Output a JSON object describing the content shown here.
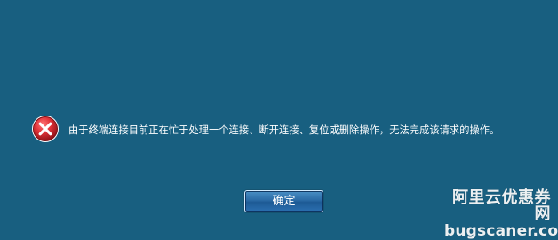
{
  "dialog": {
    "message": "由于终端连接目前正在忙于处理一个连接、断开连接、复位或删除操作，无法完成该请求的操作。",
    "ok_button_label": "确定",
    "icon": "error-icon"
  },
  "watermark": {
    "line1": "阿里云优惠券网",
    "line2": "bugscaner.com"
  },
  "colors": {
    "background": "#185f80",
    "button_top": "#4a8fc4",
    "button_bottom": "#2b6fb0",
    "error_red": "#c8202a"
  }
}
